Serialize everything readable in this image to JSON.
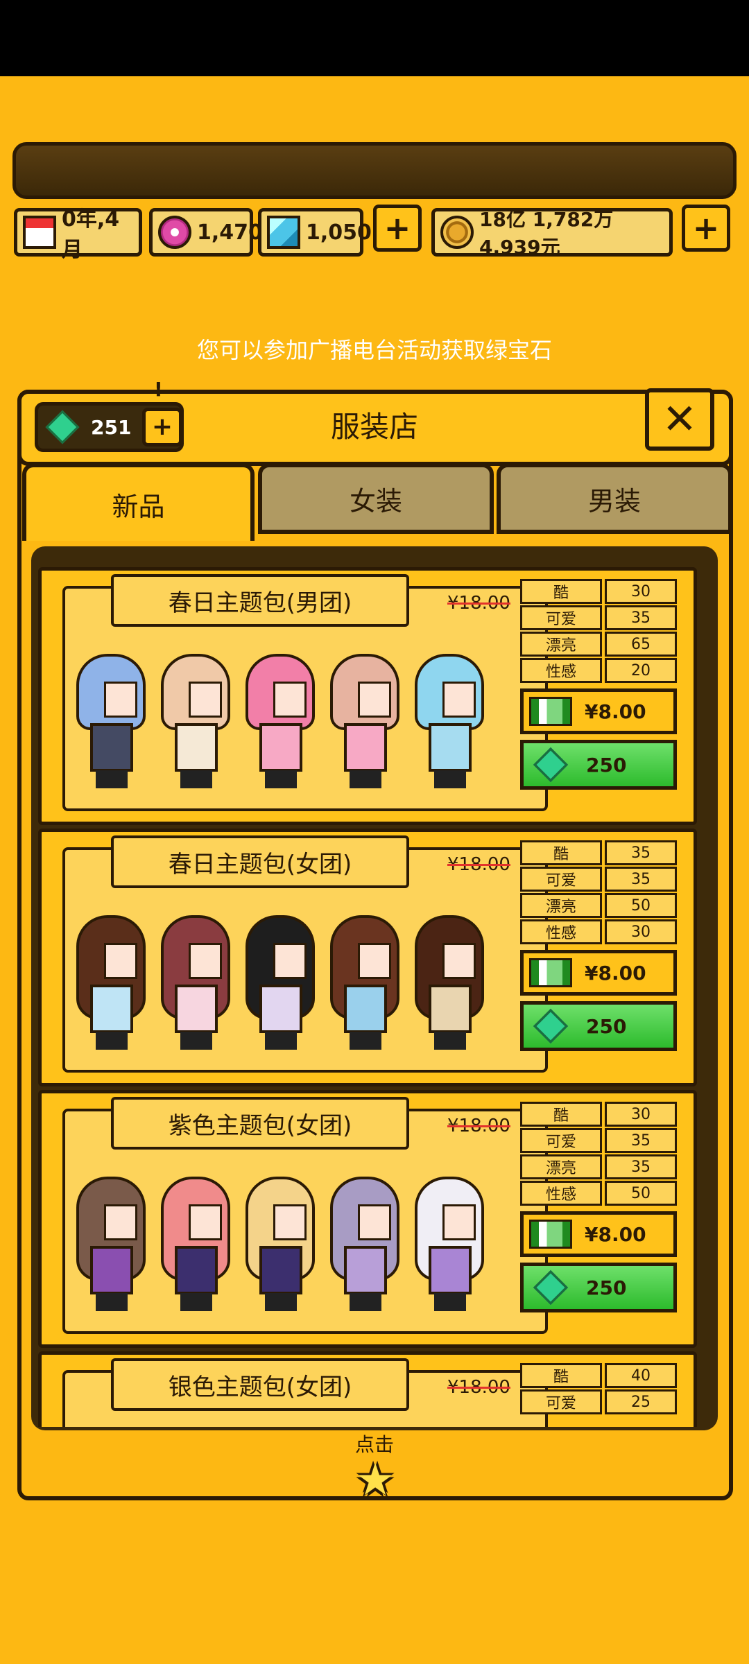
{
  "resources": {
    "date": "0年,4月",
    "candy": "1,470",
    "diamonds": "1,050",
    "money": "18亿 1,782万 4,939元",
    "plus": "+"
  },
  "hint": "您可以参加广播电台活动获取绿宝石",
  "shop": {
    "gem_count": "251",
    "gem_plus": "+",
    "alert": "!",
    "title": "服装店",
    "close": "✕"
  },
  "tabs": [
    "新品",
    "女装",
    "男装"
  ],
  "packs": [
    {
      "name": "春日主题包(男团)",
      "old_price": "¥18.00",
      "stats": [
        {
          "label": "酷",
          "value": "30"
        },
        {
          "label": "可爱",
          "value": "35"
        },
        {
          "label": "漂亮",
          "value": "65"
        },
        {
          "label": "性感",
          "value": "20"
        }
      ],
      "cash_price": "¥8.00",
      "gem_price": "250",
      "hair_colors": [
        "#8fb3e8",
        "#f0c9a8",
        "#f27fa8",
        "#e7b3a0",
        "#8fd6ef"
      ],
      "body_colors": [
        "#444a63",
        "#f5e9d6",
        "#f7a9c5",
        "#f7a9c5",
        "#a6dcf0"
      ]
    },
    {
      "name": "春日主题包(女团)",
      "old_price": "¥18.00",
      "stats": [
        {
          "label": "酷",
          "value": "35"
        },
        {
          "label": "可爱",
          "value": "35"
        },
        {
          "label": "漂亮",
          "value": "50"
        },
        {
          "label": "性感",
          "value": "30"
        }
      ],
      "cash_price": "¥8.00",
      "gem_price": "250",
      "hair_colors": [
        "#5a2e1a",
        "#8a3c40",
        "#1e1e1e",
        "#6a3420",
        "#4b2414"
      ],
      "body_colors": [
        "#bfe4f5",
        "#f7d6e0",
        "#e2d6f0",
        "#9ad0ec",
        "#e9d5b0"
      ]
    },
    {
      "name": "紫色主题包(女团)",
      "old_price": "¥18.00",
      "stats": [
        {
          "label": "酷",
          "value": "30"
        },
        {
          "label": "可爱",
          "value": "35"
        },
        {
          "label": "漂亮",
          "value": "35"
        },
        {
          "label": "性感",
          "value": "50"
        }
      ],
      "cash_price": "¥8.00",
      "gem_price": "250",
      "hair_colors": [
        "#7a5a4a",
        "#f08b8b",
        "#f4d38a",
        "#a89cc4",
        "#f0eef5"
      ],
      "body_colors": [
        "#8a4fb0",
        "#3c2f6e",
        "#3c2f6e",
        "#b89fd8",
        "#a985d4"
      ]
    },
    {
      "name": "银色主题包(女团)",
      "old_price": "¥18.00",
      "stats": [
        {
          "label": "酷",
          "value": "40"
        },
        {
          "label": "可爱",
          "value": "25"
        }
      ],
      "cash_price": "",
      "gem_price": "",
      "hair_colors": [],
      "body_colors": []
    }
  ],
  "footer": {
    "label": "点击",
    "star": "★"
  }
}
